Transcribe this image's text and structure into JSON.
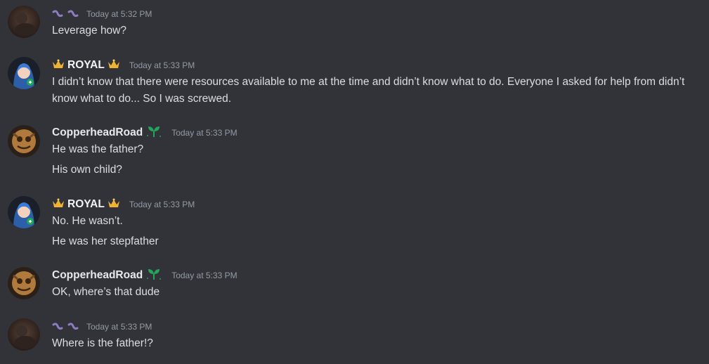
{
  "messages": [
    {
      "username": "",
      "user_style": "purple-icons",
      "timestamp": "Today at 5:32 PM",
      "lines": [
        "Leverage how?"
      ]
    },
    {
      "username": "ROYAL",
      "user_style": "crown",
      "timestamp": "Today at 5:33 PM",
      "lines": [
        "I didn’t know that there were resources available to me at the time and didn’t know what to do. Everyone I asked for help from didn’t know what to do... So I was screwed."
      ]
    },
    {
      "username": "CopperheadRoad",
      "user_style": "leaf",
      "timestamp": "Today at 5:33 PM",
      "lines": [
        "He was the father?",
        "His own child?"
      ]
    },
    {
      "username": "ROYAL",
      "user_style": "crown",
      "timestamp": "Today at 5:33 PM",
      "lines": [
        "No. He wasn’t.",
        "He was her stepfather"
      ]
    },
    {
      "username": "CopperheadRoad",
      "user_style": "leaf",
      "timestamp": "Today at 5:33 PM",
      "lines": [
        "OK, where’s that dude"
      ]
    },
    {
      "username": "",
      "user_style": "purple-icons",
      "timestamp": "Today at 5:33 PM",
      "lines": [
        "Where is the father!?"
      ]
    }
  ],
  "icons": {
    "crown": "crown-icon",
    "leaf": "sprout-icon",
    "purple": "purple-swirl-icon"
  },
  "colors": {
    "background": "#313338",
    "text": "#dbdee1",
    "timestamp": "#949ba4",
    "crown": "#f0b232",
    "leaf": "#23a55a",
    "purple": "#8e7cc3"
  }
}
